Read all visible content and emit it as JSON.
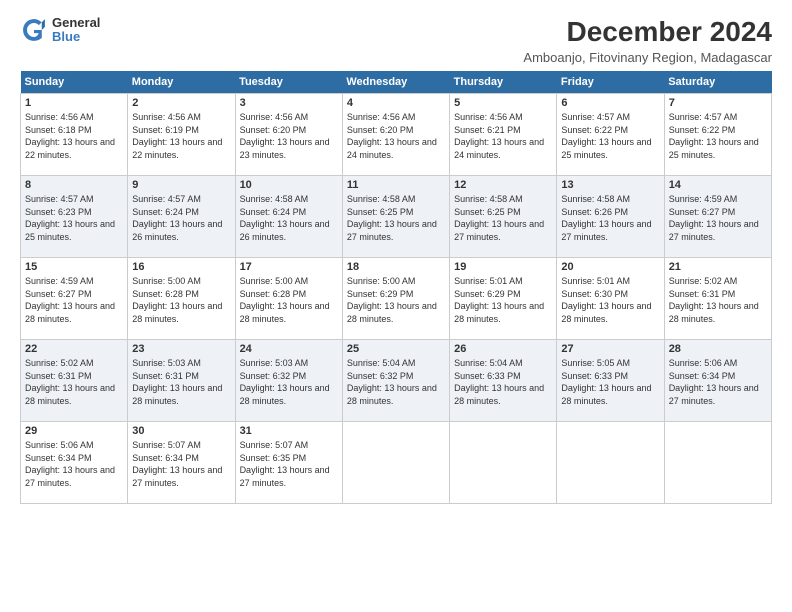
{
  "logo": {
    "line1": "General",
    "line2": "Blue"
  },
  "title": "December 2024",
  "subtitle": "Amboanjo, Fitovinany Region, Madagascar",
  "days_of_week": [
    "Sunday",
    "Monday",
    "Tuesday",
    "Wednesday",
    "Thursday",
    "Friday",
    "Saturday"
  ],
  "weeks": [
    [
      {
        "day": 1,
        "sunrise": "4:56 AM",
        "sunset": "6:18 PM",
        "daylight": "13 hours and 22 minutes."
      },
      {
        "day": 2,
        "sunrise": "4:56 AM",
        "sunset": "6:19 PM",
        "daylight": "13 hours and 22 minutes."
      },
      {
        "day": 3,
        "sunrise": "4:56 AM",
        "sunset": "6:20 PM",
        "daylight": "13 hours and 23 minutes."
      },
      {
        "day": 4,
        "sunrise": "4:56 AM",
        "sunset": "6:20 PM",
        "daylight": "13 hours and 24 minutes."
      },
      {
        "day": 5,
        "sunrise": "4:56 AM",
        "sunset": "6:21 PM",
        "daylight": "13 hours and 24 minutes."
      },
      {
        "day": 6,
        "sunrise": "4:57 AM",
        "sunset": "6:22 PM",
        "daylight": "13 hours and 25 minutes."
      },
      {
        "day": 7,
        "sunrise": "4:57 AM",
        "sunset": "6:22 PM",
        "daylight": "13 hours and 25 minutes."
      }
    ],
    [
      {
        "day": 8,
        "sunrise": "4:57 AM",
        "sunset": "6:23 PM",
        "daylight": "13 hours and 25 minutes."
      },
      {
        "day": 9,
        "sunrise": "4:57 AM",
        "sunset": "6:24 PM",
        "daylight": "13 hours and 26 minutes."
      },
      {
        "day": 10,
        "sunrise": "4:58 AM",
        "sunset": "6:24 PM",
        "daylight": "13 hours and 26 minutes."
      },
      {
        "day": 11,
        "sunrise": "4:58 AM",
        "sunset": "6:25 PM",
        "daylight": "13 hours and 27 minutes."
      },
      {
        "day": 12,
        "sunrise": "4:58 AM",
        "sunset": "6:25 PM",
        "daylight": "13 hours and 27 minutes."
      },
      {
        "day": 13,
        "sunrise": "4:58 AM",
        "sunset": "6:26 PM",
        "daylight": "13 hours and 27 minutes."
      },
      {
        "day": 14,
        "sunrise": "4:59 AM",
        "sunset": "6:27 PM",
        "daylight": "13 hours and 27 minutes."
      }
    ],
    [
      {
        "day": 15,
        "sunrise": "4:59 AM",
        "sunset": "6:27 PM",
        "daylight": "13 hours and 28 minutes."
      },
      {
        "day": 16,
        "sunrise": "5:00 AM",
        "sunset": "6:28 PM",
        "daylight": "13 hours and 28 minutes."
      },
      {
        "day": 17,
        "sunrise": "5:00 AM",
        "sunset": "6:28 PM",
        "daylight": "13 hours and 28 minutes."
      },
      {
        "day": 18,
        "sunrise": "5:00 AM",
        "sunset": "6:29 PM",
        "daylight": "13 hours and 28 minutes."
      },
      {
        "day": 19,
        "sunrise": "5:01 AM",
        "sunset": "6:29 PM",
        "daylight": "13 hours and 28 minutes."
      },
      {
        "day": 20,
        "sunrise": "5:01 AM",
        "sunset": "6:30 PM",
        "daylight": "13 hours and 28 minutes."
      },
      {
        "day": 21,
        "sunrise": "5:02 AM",
        "sunset": "6:31 PM",
        "daylight": "13 hours and 28 minutes."
      }
    ],
    [
      {
        "day": 22,
        "sunrise": "5:02 AM",
        "sunset": "6:31 PM",
        "daylight": "13 hours and 28 minutes."
      },
      {
        "day": 23,
        "sunrise": "5:03 AM",
        "sunset": "6:31 PM",
        "daylight": "13 hours and 28 minutes."
      },
      {
        "day": 24,
        "sunrise": "5:03 AM",
        "sunset": "6:32 PM",
        "daylight": "13 hours and 28 minutes."
      },
      {
        "day": 25,
        "sunrise": "5:04 AM",
        "sunset": "6:32 PM",
        "daylight": "13 hours and 28 minutes."
      },
      {
        "day": 26,
        "sunrise": "5:04 AM",
        "sunset": "6:33 PM",
        "daylight": "13 hours and 28 minutes."
      },
      {
        "day": 27,
        "sunrise": "5:05 AM",
        "sunset": "6:33 PM",
        "daylight": "13 hours and 28 minutes."
      },
      {
        "day": 28,
        "sunrise": "5:06 AM",
        "sunset": "6:34 PM",
        "daylight": "13 hours and 27 minutes."
      }
    ],
    [
      {
        "day": 29,
        "sunrise": "5:06 AM",
        "sunset": "6:34 PM",
        "daylight": "13 hours and 27 minutes."
      },
      {
        "day": 30,
        "sunrise": "5:07 AM",
        "sunset": "6:34 PM",
        "daylight": "13 hours and 27 minutes."
      },
      {
        "day": 31,
        "sunrise": "5:07 AM",
        "sunset": "6:35 PM",
        "daylight": "13 hours and 27 minutes."
      },
      null,
      null,
      null,
      null
    ]
  ]
}
